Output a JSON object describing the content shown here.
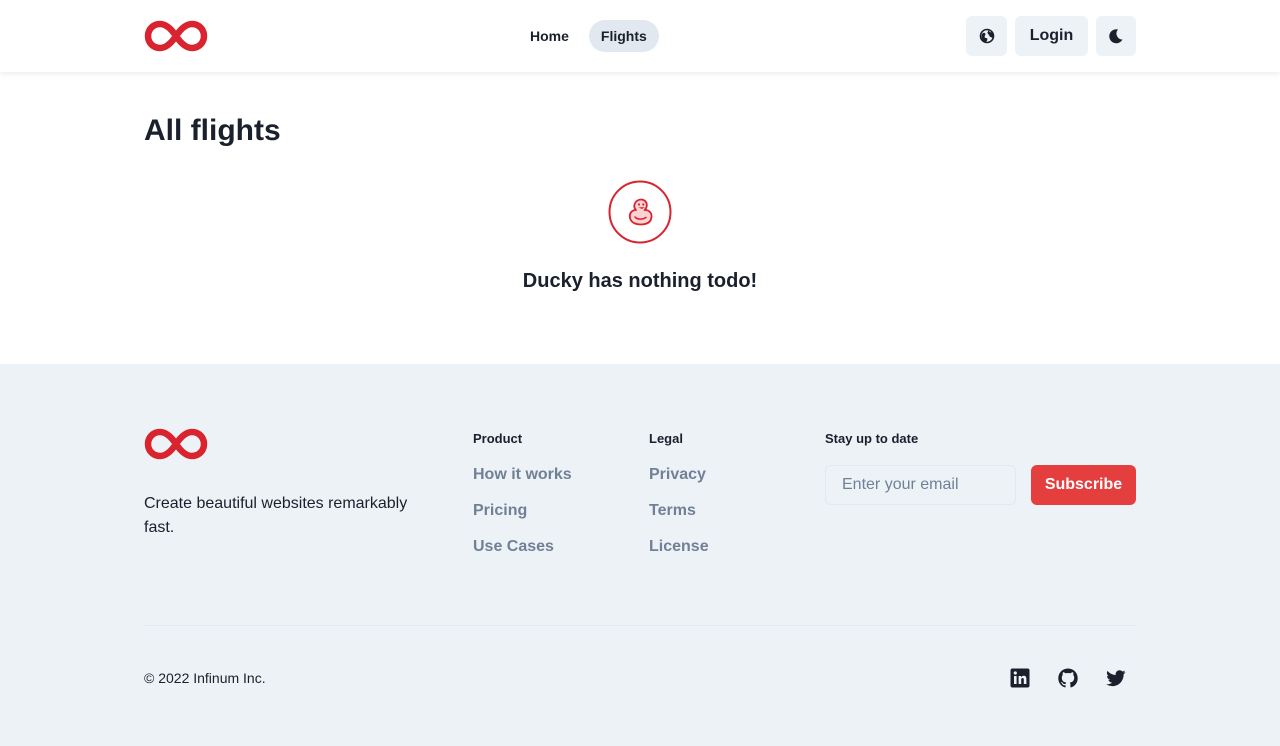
{
  "colors": {
    "brand": "#e53e3e",
    "text": "#1a202c",
    "muted": "#718096",
    "footer_bg": "#edf2f7"
  },
  "header": {
    "logo_icon": "infinity-logo",
    "nav": [
      {
        "label": "Home",
        "active": false
      },
      {
        "label": "Flights",
        "active": true
      }
    ],
    "language_icon": "globe-icon",
    "login_label": "Login",
    "theme_icon": "moon-icon"
  },
  "main": {
    "title": "All flights",
    "empty_icon": "duck-icon",
    "empty_message": "Ducky has nothing todo!"
  },
  "footer": {
    "logo_icon": "infinity-logo",
    "tagline": "Create beautiful websites remarkably fast.",
    "product": {
      "heading": "Product",
      "links": [
        "How it works",
        "Pricing",
        "Use Cases"
      ]
    },
    "legal": {
      "heading": "Legal",
      "links": [
        "Privacy",
        "Terms",
        "License"
      ]
    },
    "newsletter": {
      "heading": "Stay up to date",
      "placeholder": "Enter your email",
      "button": "Subscribe"
    },
    "copyright": "© 2022 Infinum Inc.",
    "social": [
      "linkedin-icon",
      "github-icon",
      "twitter-icon"
    ]
  }
}
